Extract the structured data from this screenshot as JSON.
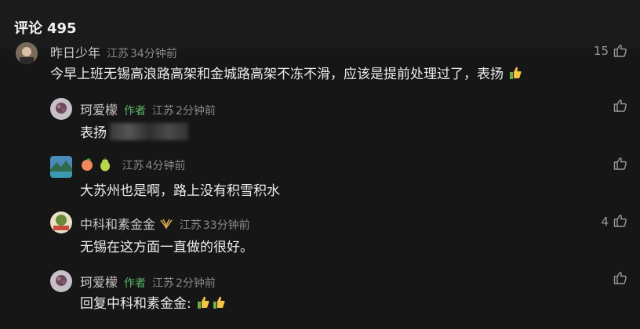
{
  "header": {
    "title": "评论",
    "count": "495"
  },
  "comments": [
    {
      "name": "昨日少年",
      "location": "江苏",
      "time": "34分钟前",
      "text": "今早上班无锡高浪路高架和金城路高架不冻不滑，应该是提前处理过了，表扬",
      "likes": "15"
    },
    {
      "name": "珂爱檬",
      "author_tag": "作者",
      "location": "江苏",
      "time": "2分钟前",
      "text": "表扬"
    },
    {
      "name": "",
      "location": "江苏",
      "time": "4分钟前",
      "text": "大苏州也是啊，路上没有积雪积水"
    },
    {
      "name": "中科和素金金",
      "location": "江苏",
      "time": "33分钟前",
      "text": "无锡在这方面一直做的很好。",
      "likes": "4"
    },
    {
      "name": "珂爱檬",
      "author_tag": "作者",
      "location": "江苏",
      "time": "2分钟前",
      "reply_prefix": "回复",
      "reply_to": "中科和素金金:"
    }
  ],
  "colors": {
    "background": "#161616",
    "author_tag": "#59b86a",
    "meta": "#8a8a8a"
  }
}
